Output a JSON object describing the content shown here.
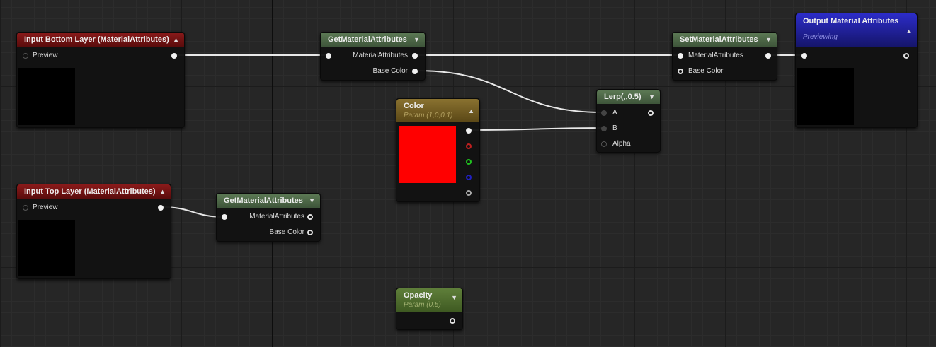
{
  "nodes": {
    "input_bottom": {
      "title": "Input Bottom Layer (MaterialAttributes)",
      "pin": "Preview"
    },
    "get1": {
      "title": "GetMaterialAttributes",
      "out1": "MaterialAttributes",
      "out2": "Base Color"
    },
    "set": {
      "title": "SetMaterialAttributes",
      "in1": "MaterialAttributes",
      "in2": "Base Color"
    },
    "output": {
      "title": "Output Material Attributes",
      "subtitle": "Previewing"
    },
    "color": {
      "title": "Color",
      "subtitle": "Param (1,0,0,1)",
      "swatch": "#ff0000"
    },
    "lerp": {
      "title": "Lerp(,,0.5)",
      "a": "A",
      "b": "B",
      "alpha": "Alpha"
    },
    "input_top": {
      "title": "Input Top Layer (MaterialAttributes)",
      "pin": "Preview"
    },
    "get2": {
      "title": "GetMaterialAttributes",
      "out1": "MaterialAttributes",
      "out2": "Base Color"
    },
    "opacity": {
      "title": "Opacity",
      "subtitle": "Param (0.5)"
    }
  }
}
